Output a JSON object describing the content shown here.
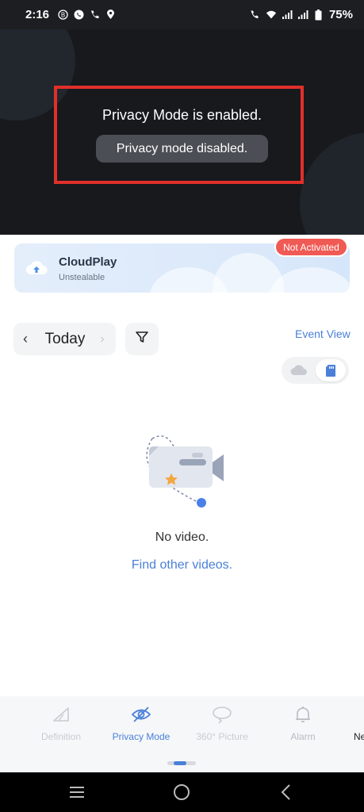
{
  "status_bar": {
    "time": "2:16",
    "left_icons": [
      "b-badge-icon",
      "whatsapp-icon",
      "phone-icon",
      "location-icon"
    ],
    "right_icons": [
      "wifi-call-icon",
      "wifi-icon",
      "signal-icon",
      "signal-icon",
      "battery-icon"
    ],
    "battery": "75%"
  },
  "video": {
    "privacy_message": "Privacy Mode is enabled.",
    "toast": "Privacy mode disabled."
  },
  "cloud_card": {
    "title": "CloudPlay",
    "subtitle": "Unstealable",
    "badge": "Not Activated"
  },
  "date_nav": {
    "label": "Today"
  },
  "event_view_label": "Event View",
  "empty_state": {
    "message": "No video.",
    "link": "Find other videos."
  },
  "toolbar": {
    "items": [
      {
        "label": "Definition",
        "icon": "definition-icon",
        "state": "disabled"
      },
      {
        "label": "Privacy Mode",
        "icon": "eye-off-icon",
        "state": "active"
      },
      {
        "label": "360° Picture",
        "icon": "rotate-icon",
        "state": "disabled"
      },
      {
        "label": "Alarm",
        "icon": "bell-icon",
        "state": "normal"
      },
      {
        "label": "Ne",
        "icon": "",
        "state": "normal"
      }
    ]
  },
  "colors": {
    "accent": "#4a80d8",
    "badge_red": "#f05a55",
    "frame_red": "#e0302a",
    "video_bg": "#17191d"
  }
}
